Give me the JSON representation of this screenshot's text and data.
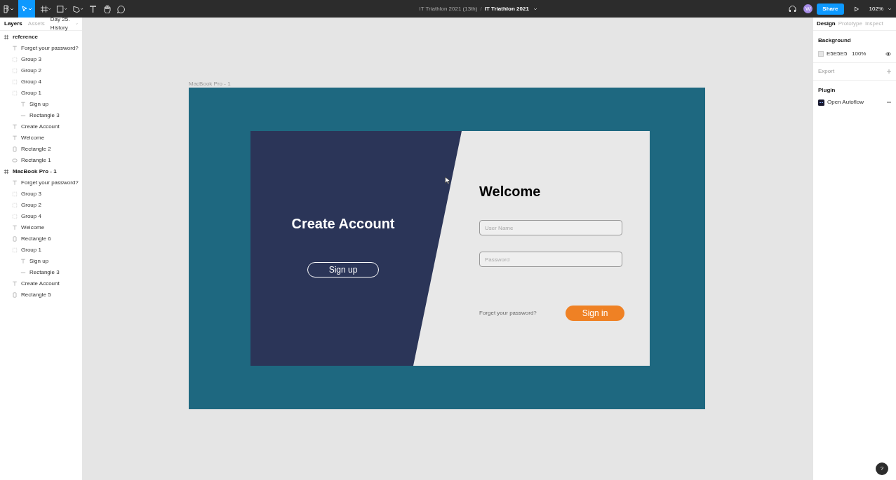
{
  "toolbar": {
    "file_path": "IT Triathlon 2021 (13th)",
    "separator": "/",
    "file_name": "IT Triathlon 2021",
    "avatar": "W",
    "share": "Share",
    "zoom": "102%"
  },
  "left_panel": {
    "tabs": [
      {
        "label": "Layers",
        "selected": true
      },
      {
        "label": "Assets",
        "selected": false
      }
    ],
    "page": "Day 25. History",
    "layers": [
      {
        "kind": "frame",
        "name": "reference",
        "children": [
          {
            "kind": "text",
            "name": "Forget your password?"
          },
          {
            "kind": "group",
            "name": "Group 3"
          },
          {
            "kind": "group",
            "name": "Group 2"
          },
          {
            "kind": "group",
            "name": "Group 4"
          },
          {
            "kind": "group",
            "name": "Group 1",
            "children": [
              {
                "kind": "text",
                "name": "Sign up"
              },
              {
                "kind": "line",
                "name": "Rectangle 3"
              }
            ]
          },
          {
            "kind": "text",
            "name": "Create Account"
          },
          {
            "kind": "text",
            "name": "Welcome"
          },
          {
            "kind": "rect",
            "name": "Rectangle 2"
          },
          {
            "kind": "pill",
            "name": "Rectangle 1"
          }
        ]
      },
      {
        "kind": "frame",
        "name": "MacBook Pro - 1",
        "children": [
          {
            "kind": "text",
            "name": "Forget your password?"
          },
          {
            "kind": "group",
            "name": "Group 3"
          },
          {
            "kind": "group",
            "name": "Group 2"
          },
          {
            "kind": "group",
            "name": "Group 4"
          },
          {
            "kind": "text",
            "name": "Welcome"
          },
          {
            "kind": "rect",
            "name": "Rectangle 6"
          },
          {
            "kind": "group",
            "name": "Group 1",
            "children": [
              {
                "kind": "text",
                "name": "Sign up"
              },
              {
                "kind": "line",
                "name": "Rectangle 3"
              }
            ]
          },
          {
            "kind": "text",
            "name": "Create Account"
          },
          {
            "kind": "rect",
            "name": "Rectangle 5"
          }
        ]
      }
    ]
  },
  "canvas": {
    "frame_label": "MacBook Pro - 1",
    "create_account": "Create Account",
    "sign_up": "Sign up",
    "welcome": "Welcome",
    "username_placeholder": "User Name",
    "password_placeholder": "Password",
    "forgot": "Forget your password?",
    "sign_in": "Sign in"
  },
  "right_panel": {
    "tabs": [
      {
        "label": "Design",
        "selected": true
      },
      {
        "label": "Prototype",
        "selected": false
      },
      {
        "label": "Inspect",
        "selected": false
      }
    ],
    "background": {
      "title": "Background",
      "color": "#e5e5e5",
      "hex": "E5E5E5",
      "opacity": "100%"
    },
    "export": "Export",
    "plugin": {
      "title": "Plugin",
      "name": "Open Autoflow"
    }
  },
  "help": "?"
}
